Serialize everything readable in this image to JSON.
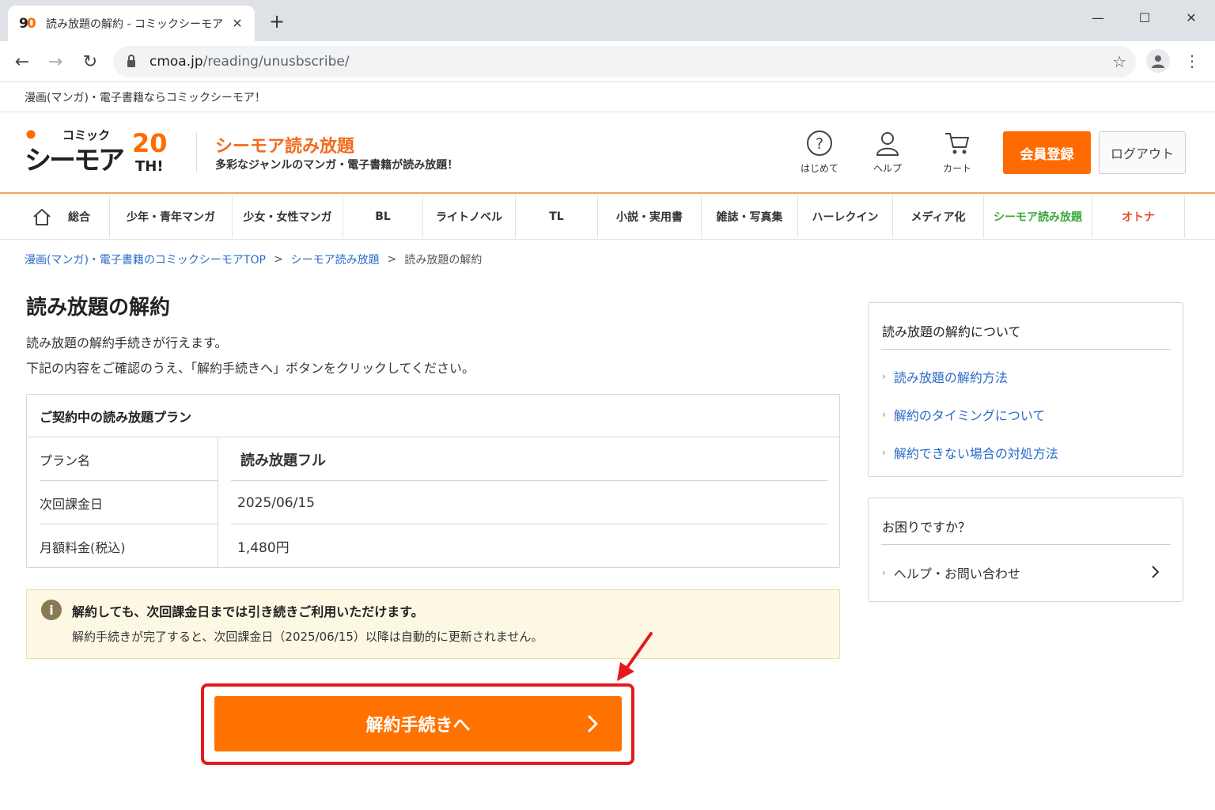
{
  "browser": {
    "tab_title": "読み放題の解約 - コミックシーモア",
    "url_host": "cmoa.jp",
    "url_path": "/reading/unusbscribe/"
  },
  "site": {
    "tagline": "漫画(マンガ)・電子書籍ならコミックシーモア！",
    "logo_small": "コミック",
    "logo_main": "シーモア",
    "logo_badge_num": "20",
    "logo_badge_text": "TH!",
    "brand_title": "シーモア読み放題",
    "brand_sub": "多彩なジャンルのマンガ・電子書籍が読み放題！",
    "header_links": [
      {
        "label": "はじめて",
        "icon": "help-circle-icon"
      },
      {
        "label": "ヘルプ",
        "icon": "user-icon"
      },
      {
        "label": "カート",
        "icon": "cart-icon"
      }
    ],
    "register_label": "会員登録",
    "logout_label": "ログアウト",
    "categories": [
      "総合",
      "少年・青年マンガ",
      "少女・女性マンガ",
      "BL",
      "ライトノベル",
      "TL",
      "小説・実用書",
      "雑誌・写真集",
      "ハーレクイン",
      "メディア化",
      "シーモア読み放題",
      "オトナ"
    ]
  },
  "breadcrumb": {
    "home": "漫画(マンガ)・電子書籍のコミックシーモアTOP",
    "sep": ">",
    "parent": "シーモア読み放題",
    "current": "読み放題の解約"
  },
  "main": {
    "title": "読み放題の解約",
    "intro1": "読み放題の解約手続きが行えます。",
    "intro2": "下記の内容をご確認のうえ、「解約手続きへ」ボタンをクリックしてください。",
    "plan_header": "ご契約中の読み放題プラン",
    "plan_rows": [
      {
        "label": "プラン名",
        "value": "読み放題フル"
      },
      {
        "label": "次回課金日",
        "value": "2025/06/15"
      },
      {
        "label": "月額料金(税込)",
        "value": "1,480円"
      }
    ],
    "notice_icon": "i",
    "notice_title": "解約しても、次回課金日までは引き続きご利用いただけます。",
    "notice_text": "解約手続きが完了すると、次回課金日（2025/06/15）以降は自動的に更新されません。",
    "cta_label": "解約手続きへ"
  },
  "sidebar": {
    "box1_title": "読み放題の解約について",
    "box1_links": [
      "読み放題の解約方法",
      "解約のタイミングについて",
      "解約できない場合の対処方法"
    ],
    "box2_title": "お困りですか？",
    "box2_link": "ヘルプ・お問い合わせ"
  },
  "colors": {
    "accent": "#ff7200",
    "brand": "#f26b1d",
    "link": "#2a6ac8",
    "highlight": "#e5191e",
    "notice_bg": "#fdf8e4"
  }
}
